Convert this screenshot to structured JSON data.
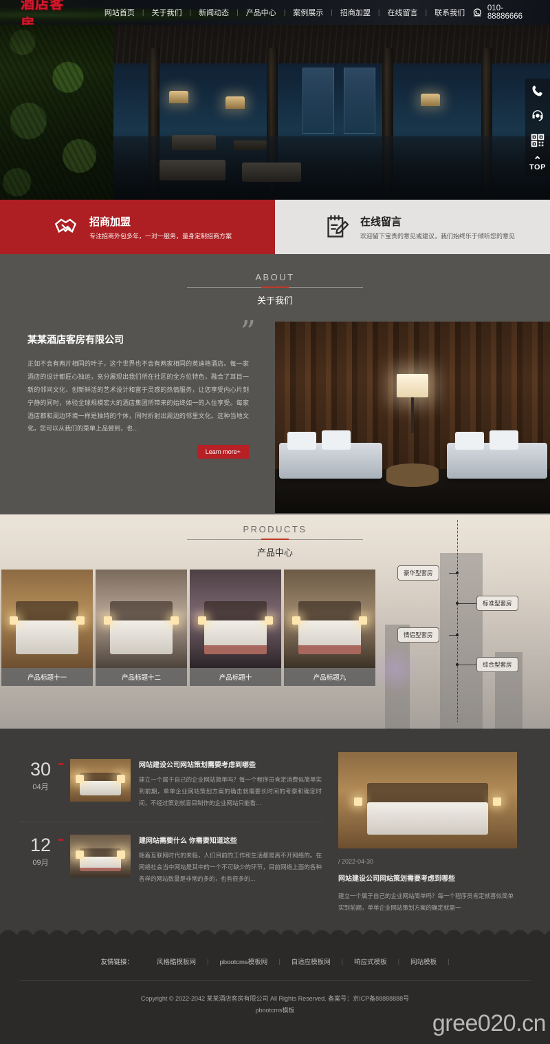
{
  "header": {
    "logo": "酒店客房",
    "nav": [
      {
        "label": "网站首页"
      },
      {
        "label": "关于我们"
      },
      {
        "label": "新闻动态"
      },
      {
        "label": "产品中心"
      },
      {
        "label": "案例展示"
      },
      {
        "label": "招商加盟"
      },
      {
        "label": "在线留言"
      },
      {
        "label": "联系我们"
      }
    ],
    "separator": "|",
    "phone": "010-88886666",
    "phone_icon": "phone-icon"
  },
  "floatbar": {
    "items": [
      {
        "icon": "phone-icon",
        "name": "float-phone"
      },
      {
        "icon": "headset-icon",
        "name": "float-service"
      },
      {
        "icon": "qrcode-icon",
        "name": "float-qrcode"
      },
      {
        "icon": "top-arrow-icon",
        "name": "float-top",
        "label": "TOP"
      }
    ]
  },
  "cta": {
    "left": {
      "icon": "handshake-icon",
      "title": "招商加盟",
      "subtitle": "专注招商外包多年，一对一服务，量身定制招商方案",
      "bg": "#ad1f22"
    },
    "right": {
      "icon": "edit-note-icon",
      "title": "在线留言",
      "subtitle": "欢迎留下宝贵的意见或建议，我们始终乐于倾听您的意见",
      "bg": "#e5e3e1"
    }
  },
  "about": {
    "en": "ABOUT",
    "cn": "关于我们",
    "company": "某某酒店客房有限公司",
    "text": "正如不会有两片相同的叶子，这个世界也不会有两家相同的英迪格酒店。每一家酒店的设计都匠心独运，充分展现出我们所在社区的全方位特色，融合了耳目一新的邻间文化、创新鲜活的艺术设计和富于灵感的热情服务，让您享受内心片刻宁静的同时，体验全球规模宏大的酒店集团所带来的始终如一的入住享受。每家酒店都和周边环境一样是独特的个体，同时折射出周边的邻里文化。这种当地文化，您可以从我们的菜单上品尝到，也…",
    "button": "Learn more+"
  },
  "products": {
    "en": "PRODUCTS",
    "cn": "产品中心",
    "cards": [
      {
        "title": "产品标题十一"
      },
      {
        "title": "产品标题十二"
      },
      {
        "title": "产品标题十"
      },
      {
        "title": "产品标题九"
      }
    ],
    "tags": [
      {
        "label": "豪华型套房"
      },
      {
        "label": "标准型套房"
      },
      {
        "label": "情侣型套房"
      },
      {
        "label": "综合型套房"
      }
    ]
  },
  "news": {
    "items": [
      {
        "day": "30",
        "month": "04月",
        "title": "网站建设公司网站策划需要考虑到哪些",
        "desc": "建立一个属于自己的企业网站简单吗？每一个程序员肯定消费似简单实到前期，单单企业网站策划方案的确击就需要长时间的考察和确定时间，不经过策划就盲目制作的企业网站只能看…"
      },
      {
        "day": "12",
        "month": "09月",
        "title": "建网站需要什么 你需要知道这些",
        "desc": "随着互联网时代的来临，人们目前的工作和生活都是离不开网络的。在网络社会当中网站是其中的一个不可缺少的环节，目前网络上面的各种各样的网站数量是非常的多的，也有很多的…"
      }
    ],
    "featured": {
      "date": "/ 2022-04-30",
      "title": "网站建设公司网站策划需要考虑到哪些",
      "desc": "建立一个属于自己的企业网站简单吗？每一个程序员肯定就喜似简单实到前期，单单企业网站策划方案的确定就需一"
    }
  },
  "footer": {
    "links_label": "友情链接：",
    "links": [
      {
        "label": "风格酷模板网"
      },
      {
        "label": "pbootcms模板网"
      },
      {
        "label": "自适应模板网"
      },
      {
        "label": "响应式模板"
      },
      {
        "label": "网站模板"
      }
    ],
    "separator": "|",
    "copyright_line1": "Copyright © 2022-2042 某某酒店客房有限公司 All Rights Reserved. 备案号：京ICP备88888888号",
    "copyright_line2": "pbootcms模板",
    "watermark": "gree020.cn"
  }
}
